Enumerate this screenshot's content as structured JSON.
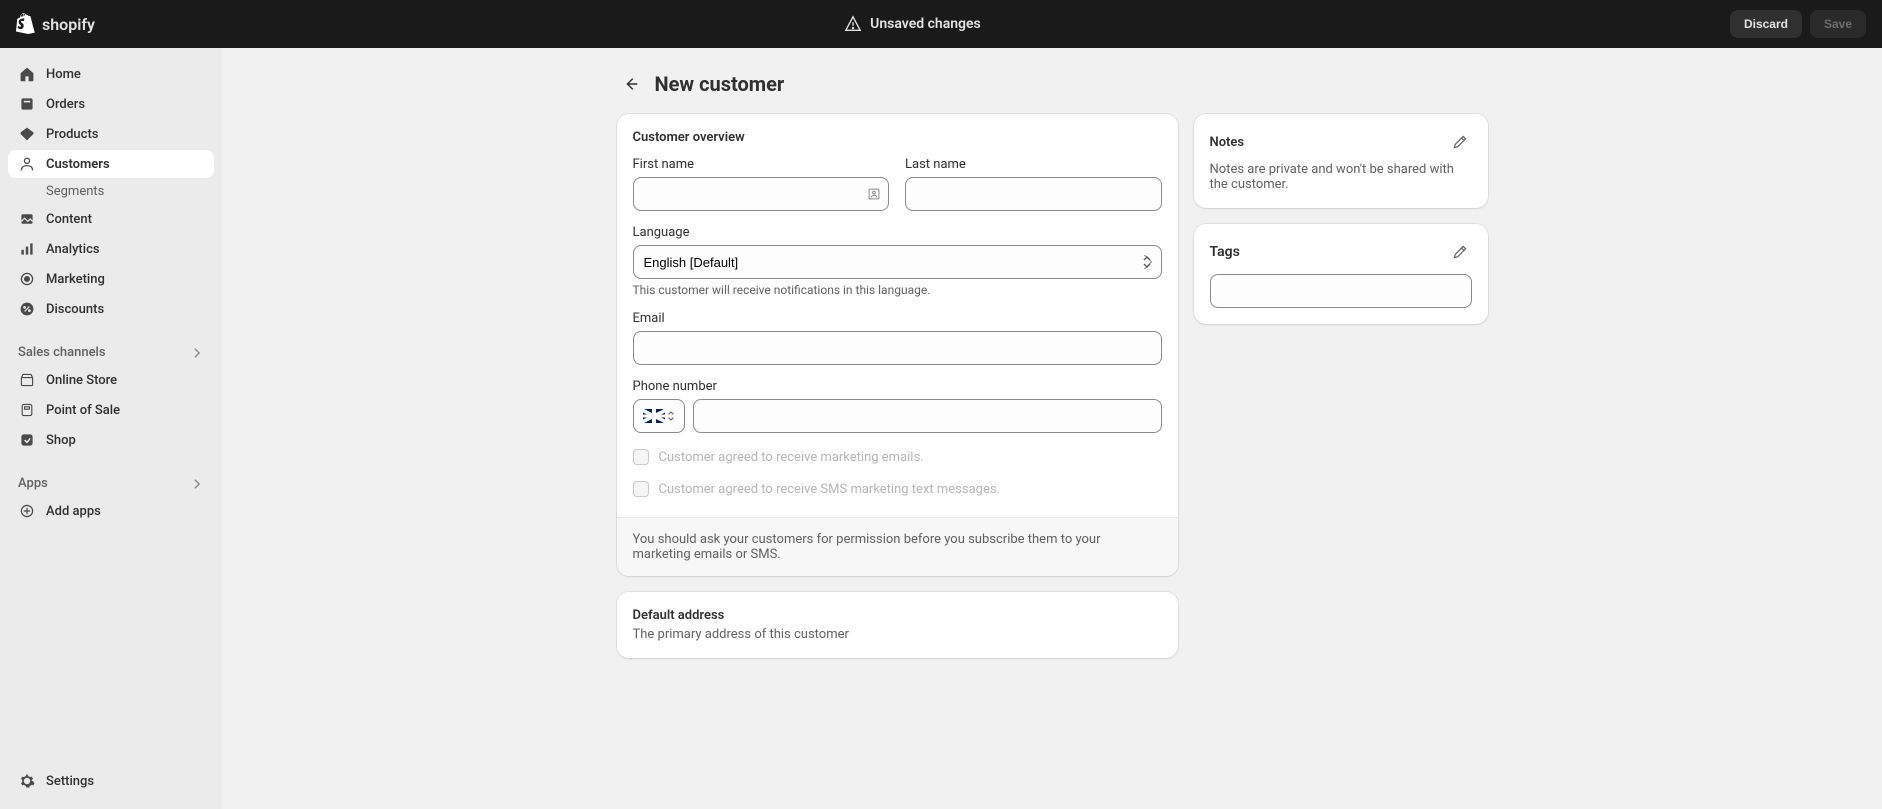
{
  "topbar": {
    "brand": "shopify",
    "status": "Unsaved changes",
    "discard": "Discard",
    "save": "Save"
  },
  "sidebar": {
    "items": [
      {
        "icon": "home",
        "label": "Home"
      },
      {
        "icon": "orders",
        "label": "Orders"
      },
      {
        "icon": "products",
        "label": "Products"
      },
      {
        "icon": "customers",
        "label": "Customers",
        "active": true,
        "sub": [
          {
            "label": "Segments"
          }
        ]
      },
      {
        "icon": "content",
        "label": "Content"
      },
      {
        "icon": "analytics",
        "label": "Analytics"
      },
      {
        "icon": "marketing",
        "label": "Marketing"
      },
      {
        "icon": "discounts",
        "label": "Discounts"
      }
    ],
    "sales_channels_header": "Sales channels",
    "sales_channels": [
      {
        "icon": "online-store",
        "label": "Online Store"
      },
      {
        "icon": "pos",
        "label": "Point of Sale"
      },
      {
        "icon": "shop",
        "label": "Shop"
      }
    ],
    "apps_header": "Apps",
    "add_apps": "Add apps",
    "settings": "Settings"
  },
  "page": {
    "title": "New customer"
  },
  "overview": {
    "heading": "Customer overview",
    "first_name_label": "First name",
    "first_name_value": "",
    "last_name_label": "Last name",
    "last_name_value": "",
    "language_label": "Language",
    "language_value": "English [Default]",
    "language_help": "This customer will receive notifications in this language.",
    "email_label": "Email",
    "email_value": "",
    "phone_label": "Phone number",
    "phone_value": "",
    "cb_email": "Customer agreed to receive marketing emails.",
    "cb_sms": "Customer agreed to receive SMS marketing text messages.",
    "footer": "You should ask your customers for permission before you subscribe them to your marketing emails or SMS."
  },
  "address": {
    "heading": "Default address",
    "subtitle": "The primary address of this customer"
  },
  "notes": {
    "heading": "Notes",
    "body": "Notes are private and won't be shared with the customer."
  },
  "tags": {
    "heading": "Tags",
    "value": ""
  }
}
